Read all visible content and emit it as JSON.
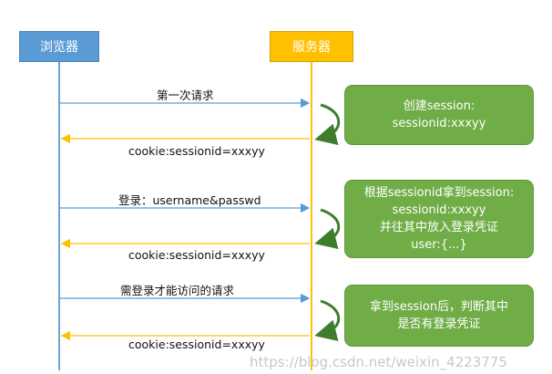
{
  "actors": {
    "browser": "浏览器",
    "server": "服务器"
  },
  "messages": {
    "m1_request": "第一次请求",
    "m1_response": "cookie:sessionid=xxxyy",
    "m2_request": "登录：username&passwd",
    "m2_response": "cookie:sessionid=xxxyy",
    "m3_request": "需登录才能访问的请求",
    "m3_response": "cookie:sessionid=xxxyy"
  },
  "notes": {
    "n1": [
      "创建session:",
      "sessionid:xxxyy"
    ],
    "n2": [
      "根据sessionid拿到session:",
      "sessionid:xxxyy",
      "并往其中放入登录凭证",
      "user:{...}"
    ],
    "n3": [
      "拿到session后，判断其中",
      "是否有登录凭证"
    ]
  },
  "watermark": "https://blog.csdn.net/weixin_4223775",
  "colors": {
    "browser": "#5b9bd5",
    "server": "#ffc000",
    "request_arrow": "#5b9bd5",
    "response_arrow": "#ffc000",
    "note": "#70ad47"
  }
}
